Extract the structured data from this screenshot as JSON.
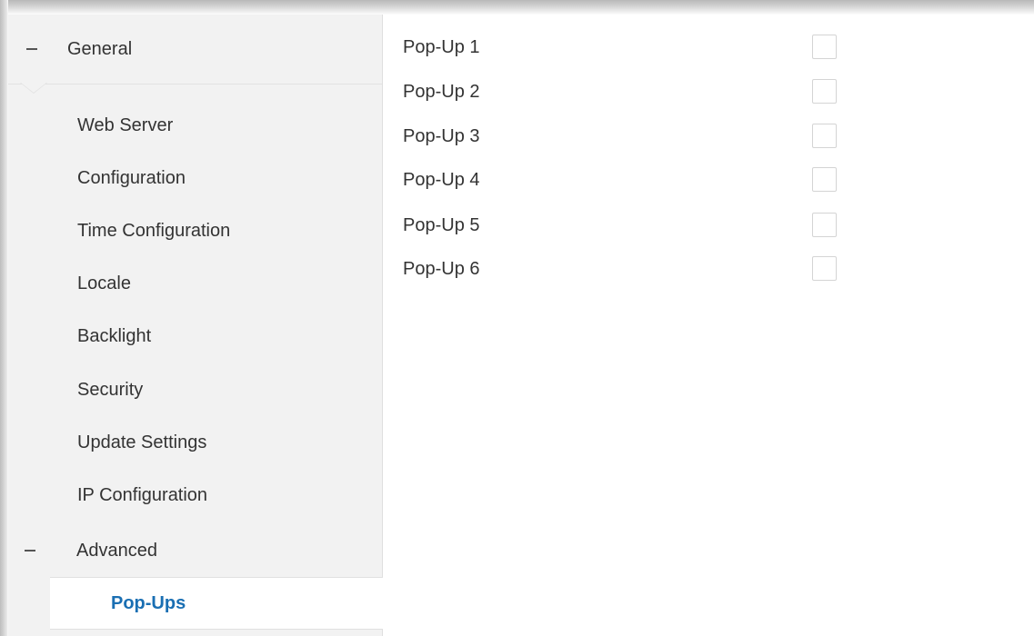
{
  "sidebar": {
    "general": {
      "label": "General",
      "items": [
        {
          "label": "Web Server"
        },
        {
          "label": "Configuration"
        },
        {
          "label": "Time Configuration"
        },
        {
          "label": "Locale"
        },
        {
          "label": "Backlight"
        },
        {
          "label": "Security"
        },
        {
          "label": "Update Settings"
        },
        {
          "label": "IP Configuration"
        }
      ]
    },
    "advanced": {
      "label": "Advanced",
      "items": [
        {
          "label": "Pop-Ups",
          "active": true
        }
      ]
    }
  },
  "content": {
    "rows": [
      {
        "label": "Pop-Up 1",
        "checked": false
      },
      {
        "label": "Pop-Up 2",
        "checked": false
      },
      {
        "label": "Pop-Up 3",
        "checked": false
      },
      {
        "label": "Pop-Up 4",
        "checked": false
      },
      {
        "label": "Pop-Up 5",
        "checked": false
      },
      {
        "label": "Pop-Up 6",
        "checked": false
      }
    ]
  },
  "colors": {
    "sidebar_bg": "#f2f2f2",
    "active_text": "#1a6fb3",
    "text": "#333333",
    "checkbox_border": "#d4d4d4"
  },
  "icons": {
    "collapse": "minus-icon"
  }
}
